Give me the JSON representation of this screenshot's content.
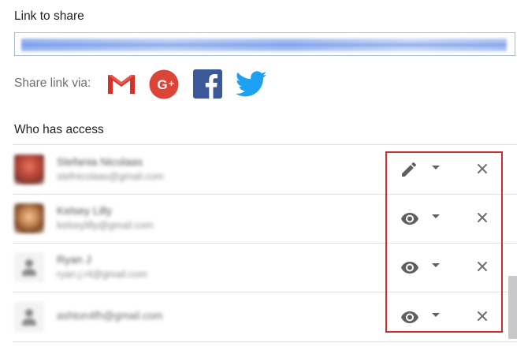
{
  "link_section": {
    "heading": "Link to share"
  },
  "share_via": {
    "label": "Share link via:",
    "targets": [
      {
        "icon": "gmail-icon",
        "color": "#d93025"
      },
      {
        "icon": "google-plus-icon",
        "color": "#db4437"
      },
      {
        "icon": "facebook-icon",
        "color": "#3b5998"
      },
      {
        "icon": "twitter-icon",
        "color": "#1da1f2"
      }
    ]
  },
  "access": {
    "heading": "Who has access",
    "people": [
      {
        "name": "Stefania Nicolaas",
        "email": "stefnicolaas@gmail.com",
        "permission": "edit",
        "permission_icon": "pencil-icon"
      },
      {
        "name": "Kelsey Lilly",
        "email": "kelseylilly@gmail.com",
        "permission": "view",
        "permission_icon": "eye-icon"
      },
      {
        "name": "Ryan J",
        "email": "ryan.j.r4@gmail.com",
        "permission": "view",
        "permission_icon": "eye-icon"
      },
      {
        "name": "",
        "email": "ashton4fh@gmail.com",
        "permission": "view",
        "permission_icon": "eye-icon"
      }
    ]
  },
  "colors": {
    "highlight": "#cc2e2e",
    "icon": "#5f5f5f",
    "link_selection": "#9bb8f2"
  }
}
